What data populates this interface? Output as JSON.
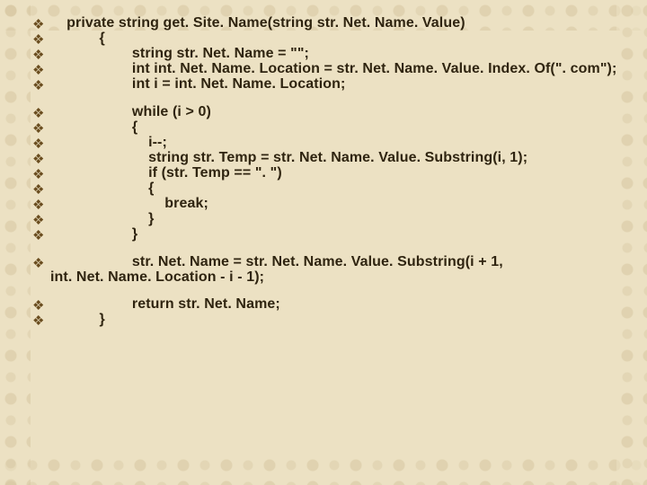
{
  "bullet_glyph": "❖",
  "blocks": [
    {
      "lines": [
        {
          "indent": 1,
          "text": "private string get. Site. Name(string str. Net. Name. Value)"
        },
        {
          "indent": 3,
          "text": "{"
        },
        {
          "indent": 5,
          "text": "string str. Net. Name = \"\";"
        },
        {
          "indent": 5,
          "text": "int int. Net. Name. Location = str. Net. Name. Value. Index. Of(\". com\");"
        },
        {
          "indent": 5,
          "text": "int i = int. Net. Name. Location;"
        }
      ]
    },
    {
      "lines": [
        {
          "indent": 5,
          "text": "while (i > 0)"
        },
        {
          "indent": 5,
          "text": "{"
        },
        {
          "indent": 6,
          "text": "i--;"
        },
        {
          "indent": 6,
          "text": "string str. Temp = str. Net. Name. Value. Substring(i, 1);"
        },
        {
          "indent": 6,
          "text": "if (str. Temp == \". \")"
        },
        {
          "indent": 6,
          "text": "{"
        },
        {
          "indent": 7,
          "text": "break;"
        },
        {
          "indent": 6,
          "text": "}"
        },
        {
          "indent": 5,
          "text": "}"
        }
      ]
    },
    {
      "lines": [
        {
          "indent": 5,
          "text": "str. Net. Name = str. Net. Name. Value. Substring(i + 1,"
        },
        {
          "indent": 0,
          "nobullet": true,
          "text": "int. Net. Name. Location - i - 1);"
        }
      ]
    },
    {
      "lines": [
        {
          "indent": 5,
          "text": "return str. Net. Name;"
        },
        {
          "indent": 3,
          "text": "}"
        }
      ]
    }
  ]
}
